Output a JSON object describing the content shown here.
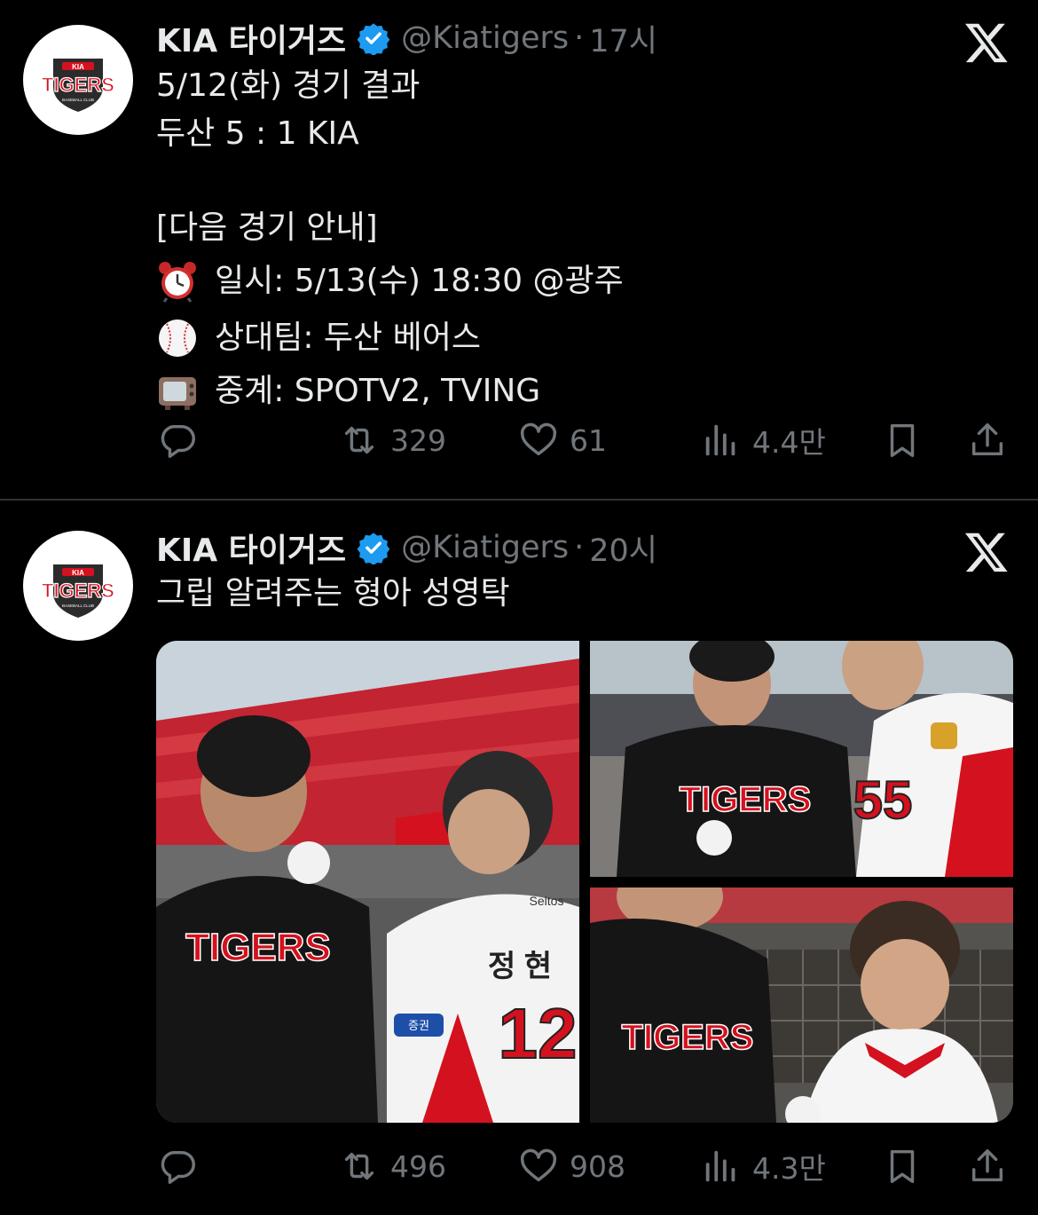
{
  "tweets": [
    {
      "author": {
        "name": "KIA 타이거즈",
        "handle": "@Kiatigers",
        "time": "17시"
      },
      "avatar_text": {
        "brand": "KIA",
        "team": "TIGERS",
        "sub": "BASEBALL CLUB"
      },
      "lines": [
        {
          "icon": "",
          "text": "5/12(화) 경기 결과"
        },
        {
          "icon": "",
          "text": "두산 5 : 1 KIA"
        },
        {
          "icon": "",
          "text": ""
        },
        {
          "icon": "",
          "text": "[다음 경기 안내]"
        },
        {
          "icon": "alarm-clock-icon",
          "text": "일시: 5/13(수) 18:30 @광주"
        },
        {
          "icon": "baseball-icon",
          "text": "상대팀: 두산 베어스"
        },
        {
          "icon": "television-icon",
          "text": "중계: SPOTV2, TVING"
        }
      ],
      "stats": {
        "replies": "",
        "retweets": "329",
        "likes": "61",
        "views": "4.4만"
      }
    },
    {
      "author": {
        "name": "KIA 타이거즈",
        "handle": "@Kiatigers",
        "time": "20시"
      },
      "avatar_text": {
        "brand": "KIA",
        "team": "TIGERS",
        "sub": "BASEBALL CLUB"
      },
      "lines": [
        {
          "icon": "",
          "text": "그립 알려주는 형아 성영탁"
        }
      ],
      "media": [
        {
          "name": "photo-stadium-group",
          "team_print": "TIGERS",
          "jersey_name": "정 현",
          "number": "12",
          "sponsor": "Seltos",
          "patch": "증권"
        },
        {
          "name": "photo-ball-grip",
          "team_print": "TIGERS",
          "jersey_number": "55"
        },
        {
          "name": "photo-dugout",
          "team_print": "TIGERS"
        }
      ],
      "stats": {
        "replies": "",
        "retweets": "496",
        "likes": "908",
        "views": "4.3만"
      }
    }
  ],
  "colors": {
    "background": "#000000",
    "text": "#e7e9ea",
    "muted": "#71767b",
    "verified": "#1d9bf0",
    "divider": "#2f3336",
    "tigers_red": "#d4111e"
  }
}
